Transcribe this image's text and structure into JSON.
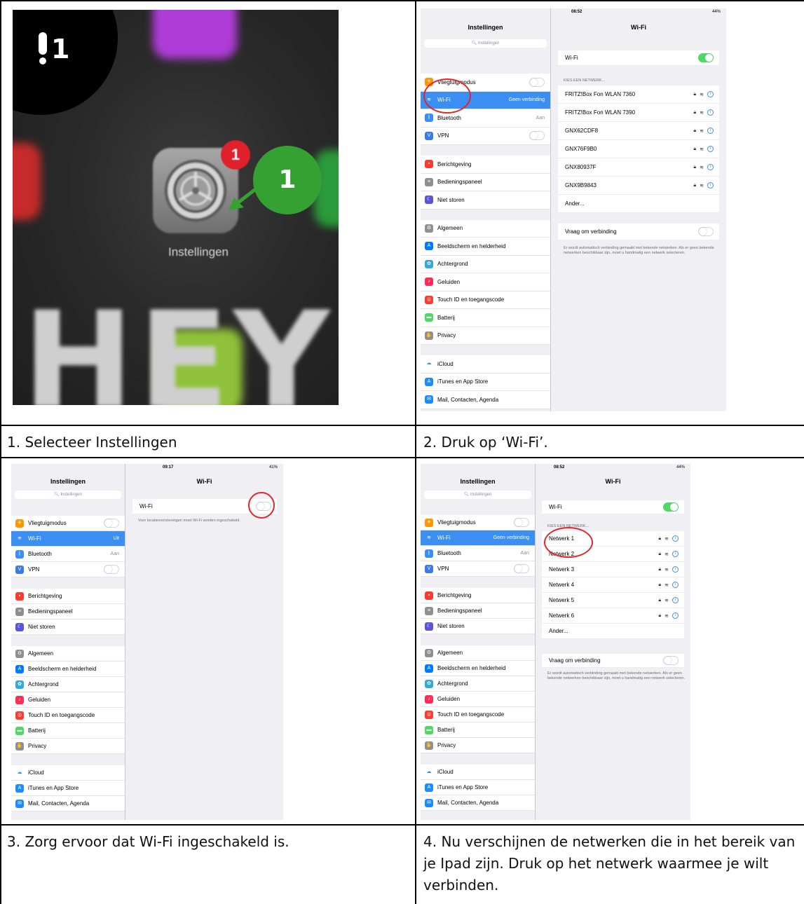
{
  "captions": {
    "step1": "1. Selecteer Instellingen",
    "step2": "2. Druk op ‘Wi-Fi’.",
    "step3": "3. Zorg ervoor dat Wi-Fi ingeschakeld is.",
    "step4": "4. Nu verschijnen de netwerken die in het bereik van je Ipad zijn. Druk op het netwerk waarmee je wilt verbinden."
  },
  "photo": {
    "corner_badge": "1",
    "app_badge": "1",
    "callout_number": "1",
    "app_label": "Instellingen",
    "background_text": "HEY"
  },
  "shot2": {
    "device": "iPad",
    "time": "08:52",
    "battery": "44%",
    "master_title": "Instellingen",
    "search_placeholder": "Instellingen",
    "rows": [
      {
        "label": "Vliegtuigmodus",
        "value": "",
        "icon_color": "#ff9500",
        "icon": "airplane-icon",
        "toggle": "off"
      },
      {
        "label": "Wi-Fi",
        "value": "Geen verbinding",
        "icon_color": "#3b8ef2",
        "icon": "wifi-icon",
        "selected": true
      },
      {
        "label": "Bluetooth",
        "value": "Aan",
        "icon_color": "#3b8ef2",
        "icon": "bluetooth-icon"
      },
      {
        "label": "VPN",
        "value": "",
        "icon_color": "#3b7ae8",
        "icon": "vpn-icon",
        "toggle": "off"
      },
      {
        "label": "Berichtgeving",
        "value": "",
        "icon_color": "#ff3b30",
        "icon": "notifications-icon"
      },
      {
        "label": "Bedieningspaneel",
        "value": "",
        "icon_color": "#8e8e93",
        "icon": "control-center-icon"
      },
      {
        "label": "Niet storen",
        "value": "",
        "icon_color": "#5856d6",
        "icon": "moon-icon"
      },
      {
        "label": "Algemeen",
        "value": "",
        "icon_color": "#8e8e93",
        "icon": "gear-icon"
      },
      {
        "label": "Beeldscherm en helderheid",
        "value": "",
        "icon_color": "#007aff",
        "icon": "display-icon"
      },
      {
        "label": "Achtergrond",
        "value": "",
        "icon_color": "#34aadc",
        "icon": "wallpaper-icon"
      },
      {
        "label": "Geluiden",
        "value": "",
        "icon_color": "#ff2d55",
        "icon": "sound-icon"
      },
      {
        "label": "Touch ID en toegangscode",
        "value": "",
        "icon_color": "#ff3b30",
        "icon": "fingerprint-icon"
      },
      {
        "label": "Batterij",
        "value": "",
        "icon_color": "#4cd964",
        "icon": "battery-icon"
      },
      {
        "label": "Privacy",
        "value": "",
        "icon_color": "#8e8e93",
        "icon": "hand-icon"
      },
      {
        "label": "iCloud",
        "value": "",
        "icon_color": "#ffffff",
        "icon": "cloud-icon"
      },
      {
        "label": "iTunes en App Store",
        "value": "",
        "icon_color": "#1a8cff",
        "icon": "app-store-icon"
      },
      {
        "label": "Mail, Contacten, Agenda",
        "value": "",
        "icon_color": "#1a8cff",
        "icon": "mail-icon"
      }
    ],
    "detail_title": "Wi-Fi",
    "wifi_label": "Wi-Fi",
    "wifi_toggle": "on",
    "networks_header": "KIES EEN NETWERK...",
    "networks": [
      "FRITZ!Box Fon WLAN 7360",
      "FRITZ!Box Fon WLAN 7390",
      "GNX62CDF8",
      "GNX76F9B0",
      "GNX80937F",
      "GNX9B9843"
    ],
    "other_label": "Ander...",
    "ask_label": "Vraag om verbinding",
    "ask_toggle": "off",
    "footer": "Er wordt automatisch verbinding gemaakt met bekende netwerken. Als er geen bekende netwerken beschikbaar zijn, moet u handmatig een netwerk selecteren."
  },
  "shot3": {
    "device": "iPad",
    "time": "09:17",
    "battery": "41%",
    "master_title": "Instellingen",
    "search_placeholder": "Instellingen",
    "wifi_row_value": "Uit",
    "bluetooth_value": "Aan",
    "detail_title": "Wi-Fi",
    "wifi_label": "Wi-Fi",
    "wifi_toggle": "off",
    "footer": "Voor locatievoorzieningen moet Wi-Fi worden ingeschakeld."
  },
  "shot4": {
    "device": "iPad",
    "time": "08:52",
    "battery": "44%",
    "master_title": "Instellingen",
    "search_placeholder": "Instellingen",
    "wifi_row_value": "Geen verbinding",
    "bluetooth_value": "Aan",
    "detail_title": "Wi-Fi",
    "wifi_label": "Wi-Fi",
    "wifi_toggle": "on",
    "networks_header": "KIES EEN NETWERK...",
    "networks": [
      "Netwerk 1",
      "Netwerk 2",
      "Netwerk 3",
      "Netwerk 4",
      "Netwerk 5",
      "Netwerk 6"
    ],
    "other_label": "Ander...",
    "ask_label": "Vraag om verbinding",
    "ask_toggle": "off",
    "footer": "Er wordt automatisch verbinding gemaakt met bekende netwerken. Als er geen bekende netwerken beschikbaar zijn, moet u handmatig een netwerk selecteren."
  }
}
